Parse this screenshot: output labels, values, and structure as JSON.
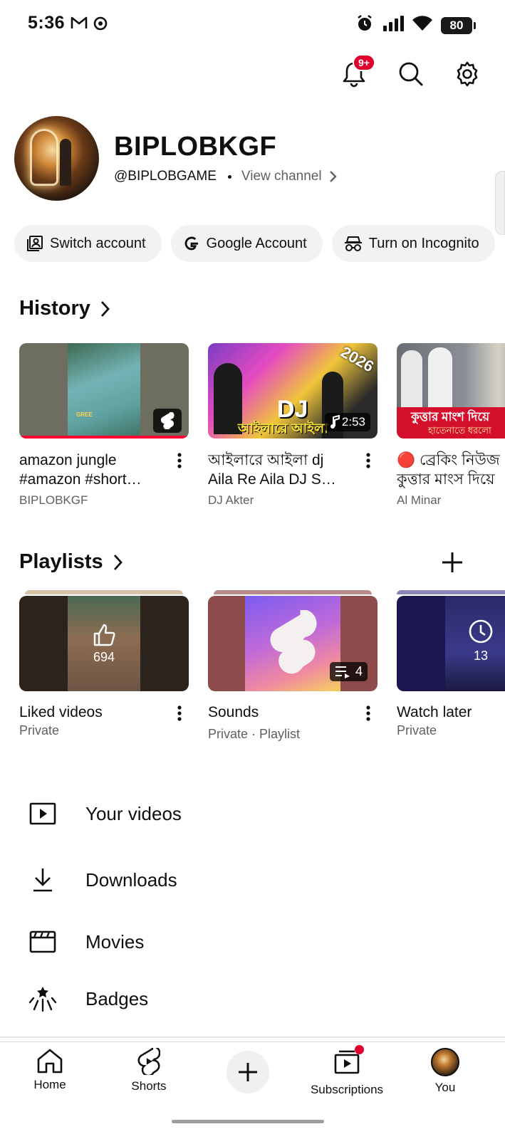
{
  "status_bar": {
    "time": "5:36",
    "battery": "80"
  },
  "notifications": {
    "badge": "9+"
  },
  "profile": {
    "name": "BIPLOBKGF",
    "handle": "@BIPLOBGAME",
    "view_channel": "View channel"
  },
  "chips": [
    {
      "label": "Switch account",
      "icon": "switch-account-icon"
    },
    {
      "label": "Google Account",
      "icon": "google-icon"
    },
    {
      "label": "Turn on Incognito",
      "icon": "incognito-icon"
    }
  ],
  "history": {
    "title": "History",
    "items": [
      {
        "title_line1": "amazon jungle",
        "title_line2": "#amazon #short…",
        "channel": "BIPLOBKGF",
        "thumb_text": "GREE",
        "progress": 1.0
      },
      {
        "title_line1": "আইলারে আইলা dj",
        "title_line2": "Aila Re Aila DJ S…",
        "channel": "DJ Akter",
        "duration": "2:53",
        "thumb_big": "DJ",
        "thumb_year": "2026",
        "thumb_caption": "আইলারে আইলা"
      },
      {
        "title_line1": "🔴 ব্রেকিং নিউজ",
        "title_line2": "কুত্তার মাংস দিয়ে",
        "channel": "Al Minar",
        "thumb_caption": "কুত্তার মাংশ দিয়ে",
        "thumb_caption2": "হাতেনাতে ধরলো"
      }
    ]
  },
  "playlists": {
    "title": "Playlists",
    "items": [
      {
        "title": "Liked videos",
        "sub": "Private",
        "count": "694"
      },
      {
        "title": "Sounds",
        "sub": "Private · Playlist",
        "count": "4"
      },
      {
        "title": "Watch later",
        "sub": "Private",
        "count": "13"
      }
    ]
  },
  "menu": [
    {
      "label": "Your videos",
      "icon": "your-videos-icon"
    },
    {
      "label": "Downloads",
      "icon": "download-icon"
    },
    {
      "label": "Movies",
      "icon": "movies-icon"
    },
    {
      "label": "Badges",
      "icon": "badges-icon"
    }
  ],
  "bottom_nav": {
    "home": "Home",
    "shorts": "Shorts",
    "subscriptions": "Subscriptions",
    "you": "You"
  },
  "colors": {
    "accent_red": "#ff0033",
    "badge_red": "#e1002d",
    "chip_bg": "#f2f2f2",
    "secondary_text": "#606060"
  }
}
